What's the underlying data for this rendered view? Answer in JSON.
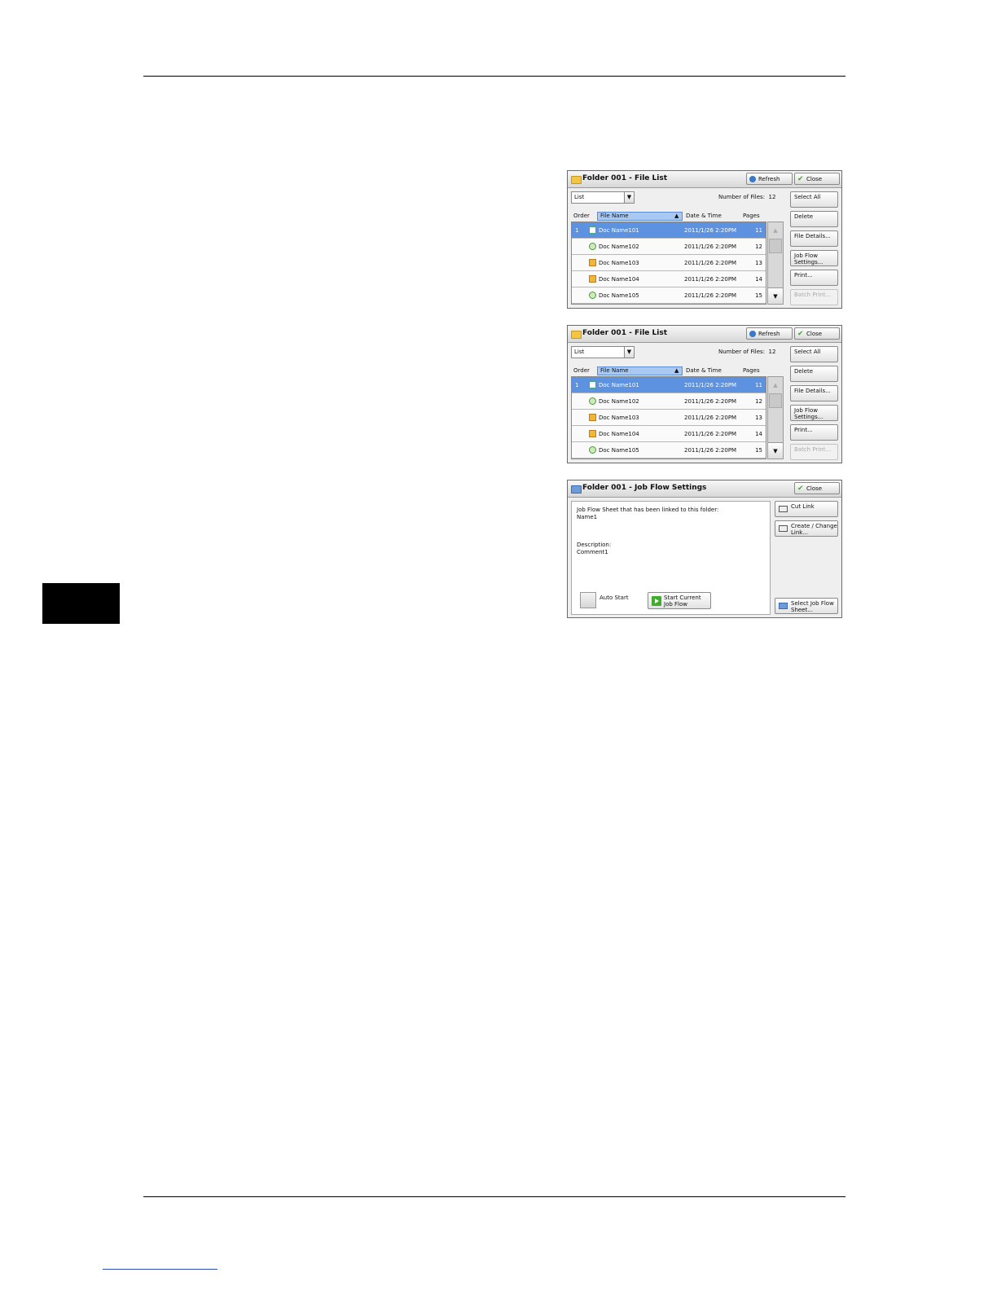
{
  "screens": [
    {
      "title": "Folder 001 - File List",
      "refresh_label": "Refresh",
      "close_label": "Close",
      "view_select": "List",
      "number_of_files_label": "Number of Files:",
      "number_of_files": "12",
      "columns": [
        "Order",
        "File Name",
        "Date & Time",
        "Pages"
      ],
      "rows": [
        {
          "order": "1",
          "name": "Doc Name101",
          "datetime": "2011/1/26  2:20PM",
          "pages": "11",
          "icon": "scan-doc"
        },
        {
          "order": "",
          "name": "Doc Name102",
          "datetime": "2011/1/26  2:20PM",
          "pages": "12",
          "icon": "fax-doc"
        },
        {
          "order": "",
          "name": "Doc Name103",
          "datetime": "2011/1/26  2:20PM",
          "pages": "13",
          "icon": "print-doc"
        },
        {
          "order": "",
          "name": "Doc Name104",
          "datetime": "2011/1/26  2:20PM",
          "pages": "14",
          "icon": "print-doc"
        },
        {
          "order": "",
          "name": "Doc Name105",
          "datetime": "2011/1/26  2:20PM",
          "pages": "15",
          "icon": "fax-doc"
        }
      ],
      "buttons": [
        "Select All",
        "Delete",
        "File Details...",
        "Job Flow Settings...",
        "Print...",
        "Batch Print..."
      ]
    },
    {
      "title": "Folder 001 - File List",
      "refresh_label": "Refresh",
      "close_label": "Close",
      "view_select": "List",
      "number_of_files_label": "Number of Files:",
      "number_of_files": "12",
      "columns": [
        "Order",
        "File Name",
        "Date & Time",
        "Pages"
      ],
      "rows": [
        {
          "order": "1",
          "name": "Doc Name101",
          "datetime": "2011/1/26  2:20PM",
          "pages": "11",
          "icon": "scan-doc"
        },
        {
          "order": "",
          "name": "Doc Name102",
          "datetime": "2011/1/26  2:20PM",
          "pages": "12",
          "icon": "fax-doc"
        },
        {
          "order": "",
          "name": "Doc Name103",
          "datetime": "2011/1/26  2:20PM",
          "pages": "13",
          "icon": "print-doc"
        },
        {
          "order": "",
          "name": "Doc Name104",
          "datetime": "2011/1/26  2:20PM",
          "pages": "14",
          "icon": "print-doc"
        },
        {
          "order": "",
          "name": "Doc Name105",
          "datetime": "2011/1/26  2:20PM",
          "pages": "15",
          "icon": "fax-doc"
        }
      ],
      "buttons": [
        "Select All",
        "Delete",
        "File Details...",
        "Job Flow Settings...",
        "Print...",
        "Batch Print..."
      ]
    }
  ],
  "jobflow": {
    "title": "Folder 001 - Job Flow Settings",
    "close_label": "Close",
    "linked_label": "Job Flow Sheet that has been linked to this folder:",
    "linked_value": "Name1",
    "description_label": "Description:",
    "description_value": "Comment1",
    "auto_start_label": "Auto Start",
    "start_button": "Start Current Job Flow",
    "cut_link_button": "Cut Link",
    "create_link_button": "Create / Change Link...",
    "select_sheet_button": "Select Job Flow Sheet..."
  }
}
